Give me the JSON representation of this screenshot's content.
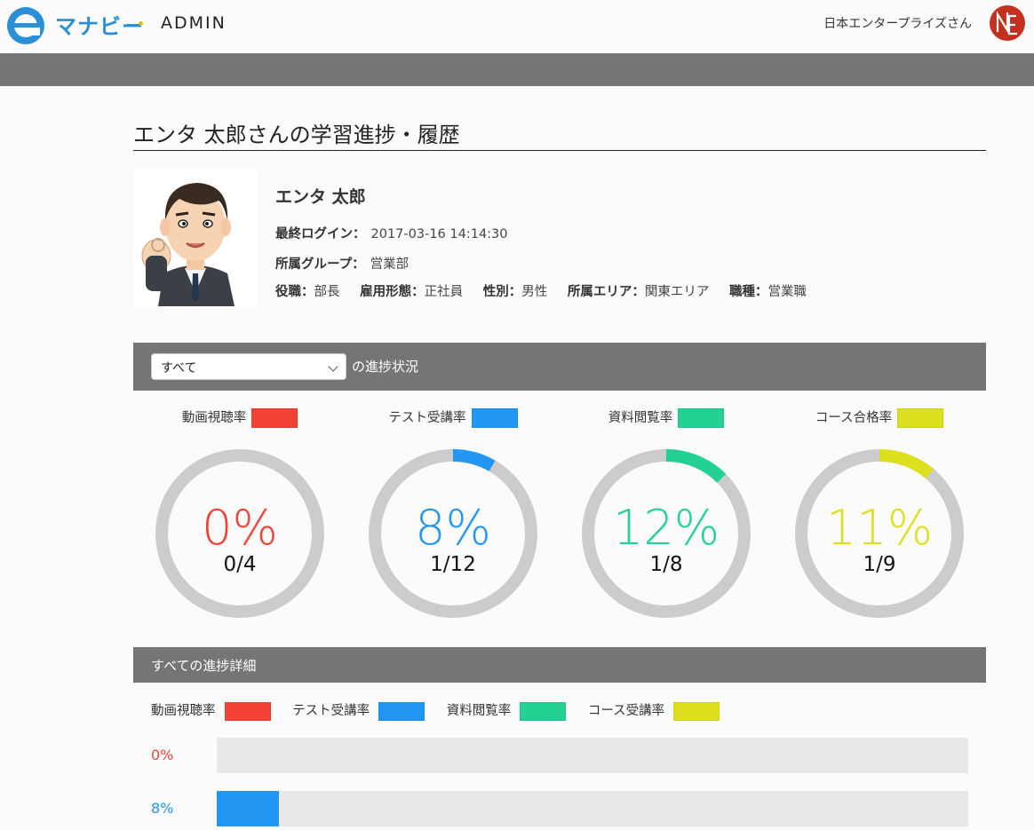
{
  "header": {
    "brand": "マナビー",
    "admin_label": "ADMIN",
    "company": "日本エンタープライズさん",
    "avatar_icon": "company-logo-icon"
  },
  "page": {
    "title": "エンタ 太郎さんの学習進捗・履歴"
  },
  "profile": {
    "name": "エンタ 太郎",
    "last_login_label": "最終ログイン：",
    "last_login_value": "2017-03-16 14:14:30",
    "group_label": "所属グループ：",
    "group_value": "営業部",
    "position_label": "役職：",
    "position_value": "部長",
    "employment_label": "雇用形態：",
    "employment_value": "正社員",
    "gender_label": "性別：",
    "gender_value": "男性",
    "area_label": "所属エリア：",
    "area_value": "関東エリア",
    "job_label": "職種：",
    "job_value": "営業職"
  },
  "progress": {
    "filter_value": "すべて",
    "section_label": "の進捗状況",
    "gauges": [
      {
        "label": "動画視聴率",
        "percent_text": "0%",
        "fraction": "0/4",
        "value": 0,
        "color": "#f24236"
      },
      {
        "label": "テスト受講率",
        "percent_text": "8%",
        "fraction": "1/12",
        "value": 0.0833,
        "color": "#2196f3"
      },
      {
        "label": "資料閲覧率",
        "percent_text": "12%",
        "fraction": "1/8",
        "value": 0.125,
        "color": "#23d193"
      },
      {
        "label": "コース合格率",
        "percent_text": "11%",
        "fraction": "1/9",
        "value": 0.1111,
        "color": "#dde01e"
      }
    ]
  },
  "details": {
    "section_label": "すべての進捗詳細",
    "legend": [
      {
        "label": "動画視聴率",
        "color": "#f24236"
      },
      {
        "label": "テスト受講率",
        "color": "#2196f3"
      },
      {
        "label": "資料閲覧率",
        "color": "#23d193"
      },
      {
        "label": "コース受講率",
        "color": "#dde01e"
      }
    ],
    "bars": [
      {
        "percent_text": "0%",
        "value": 0,
        "color": "#f24236"
      },
      {
        "percent_text": "8%",
        "value": 0.083,
        "color": "#2196f3"
      }
    ]
  }
}
